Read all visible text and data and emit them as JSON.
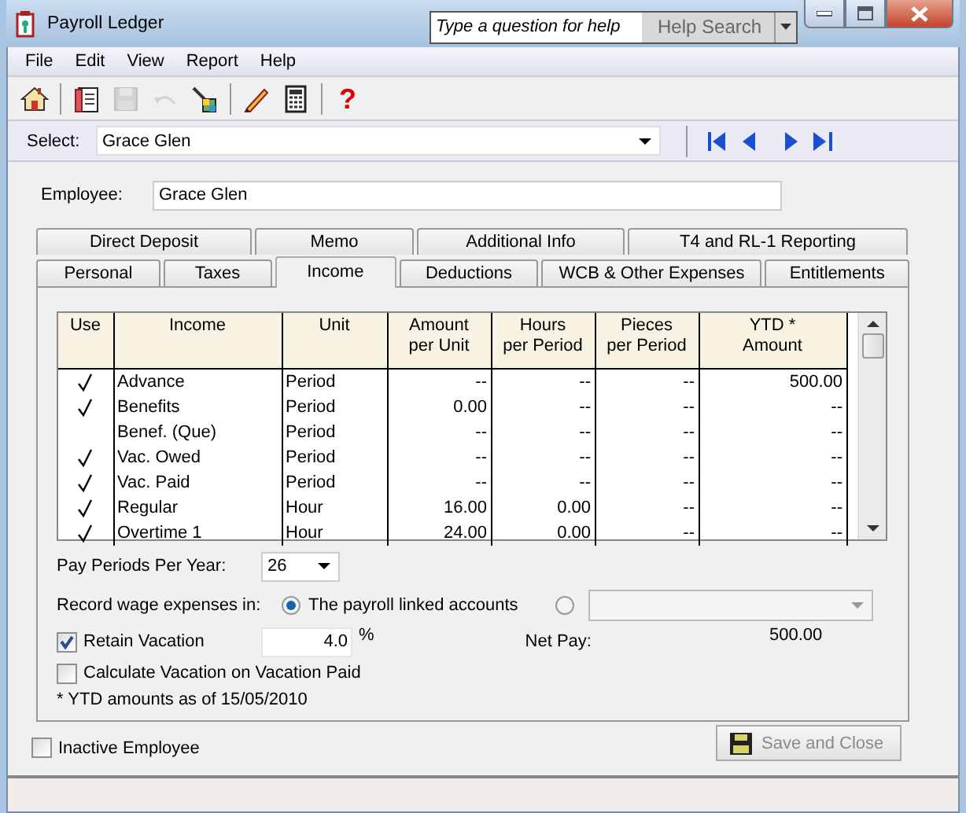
{
  "window": {
    "title": "Payroll Ledger"
  },
  "help": {
    "placeholder": "Type a question for help",
    "button": "Help Search"
  },
  "menu": [
    "File",
    "Edit",
    "View",
    "Report",
    "Help"
  ],
  "toolbar": [
    {
      "kind": "home",
      "disabled": false
    },
    {
      "kind": "journal",
      "disabled": false
    },
    {
      "kind": "save",
      "disabled": true
    },
    {
      "kind": "undo",
      "disabled": true
    },
    {
      "kind": "wizard",
      "disabled": false
    },
    {
      "kind": "pencil",
      "disabled": false
    },
    {
      "kind": "calculator",
      "disabled": false
    },
    {
      "kind": "help",
      "disabled": false,
      "text": "?"
    }
  ],
  "select": {
    "label": "Select:",
    "value": "Grace Glen"
  },
  "employee": {
    "label": "Employee:",
    "value": "Grace Glen"
  },
  "tabs_back": [
    {
      "label": "Direct Deposit",
      "selected": false
    },
    {
      "label": "Memo",
      "selected": false
    },
    {
      "label": "Additional Info",
      "selected": false
    },
    {
      "label": "T4 and RL-1 Reporting",
      "selected": false
    }
  ],
  "tabs_front": [
    {
      "label": "Personal",
      "selected": false
    },
    {
      "label": "Taxes",
      "selected": false
    },
    {
      "label": "Income",
      "selected": true
    },
    {
      "label": "Deductions",
      "selected": false
    },
    {
      "label": "WCB & Other Expenses",
      "selected": false
    },
    {
      "label": "Entitlements",
      "selected": false
    }
  ],
  "table": {
    "columns": [
      [
        "Use"
      ],
      [
        "Income"
      ],
      [
        "Unit"
      ],
      [
        "Amount",
        "per Unit"
      ],
      [
        "Hours",
        "per Period"
      ],
      [
        "Pieces",
        "per Period"
      ],
      [
        "YTD *",
        "Amount"
      ]
    ],
    "rows": [
      {
        "use": true,
        "income": "Advance",
        "unit": "Period",
        "amount": "--",
        "hours": "--",
        "pieces": "--",
        "ytd": "500.00"
      },
      {
        "use": true,
        "income": "Benefits",
        "unit": "Period",
        "amount": "0.00",
        "hours": "--",
        "pieces": "--",
        "ytd": "--"
      },
      {
        "use": false,
        "income": "Benef. (Que)",
        "unit": "Period",
        "amount": "--",
        "hours": "--",
        "pieces": "--",
        "ytd": "--"
      },
      {
        "use": true,
        "income": "Vac. Owed",
        "unit": "Period",
        "amount": "--",
        "hours": "--",
        "pieces": "--",
        "ytd": "--"
      },
      {
        "use": true,
        "income": "Vac. Paid",
        "unit": "Period",
        "amount": "--",
        "hours": "--",
        "pieces": "--",
        "ytd": "--"
      },
      {
        "use": true,
        "income": "Regular",
        "unit": "Hour",
        "amount": "16.00",
        "hours": "0.00",
        "pieces": "--",
        "ytd": "--"
      },
      {
        "use": true,
        "income": "Overtime 1",
        "unit": "Hour",
        "amount": "24.00",
        "hours": "0.00",
        "pieces": "--",
        "ytd": "--"
      }
    ]
  },
  "pay_periods": {
    "label": "Pay Periods Per Year:",
    "value": "26"
  },
  "record_wage": {
    "label": "Record wage expenses in:",
    "options": [
      {
        "label": "The payroll linked accounts",
        "selected": true
      },
      {
        "selected": false
      }
    ]
  },
  "retain_vacation": {
    "label": "Retain Vacation",
    "checked": true,
    "value": "4.0",
    "unit": "%"
  },
  "net_pay": {
    "label": "Net Pay:",
    "value": "500.00"
  },
  "calc_vacation": {
    "label": "Calculate Vacation on Vacation Paid",
    "checked": false
  },
  "footnote": "* YTD amounts as of 15/05/2010",
  "inactive": {
    "label": "Inactive Employee",
    "checked": false
  },
  "save_button": {
    "label": "Save and Close",
    "disabled": true
  }
}
